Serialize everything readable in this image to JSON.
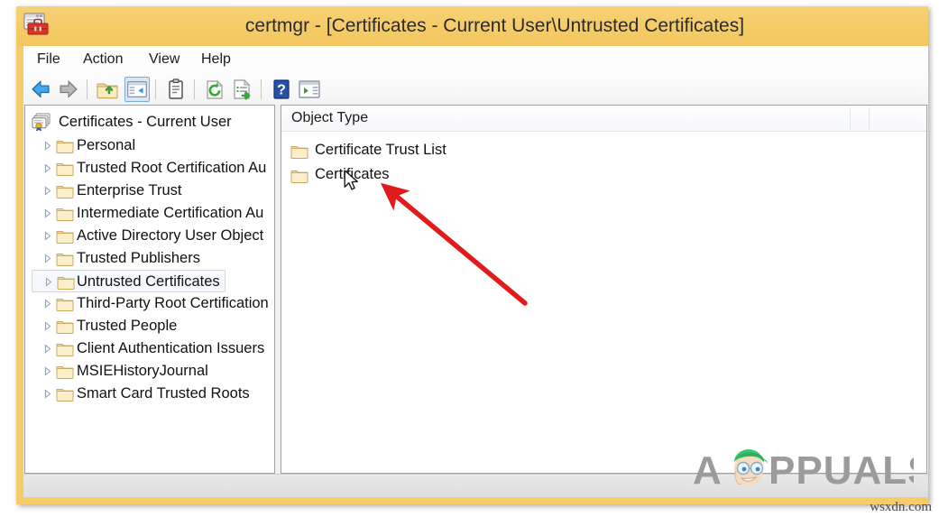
{
  "window": {
    "title": "certmgr - [Certificates - Current User\\Untrusted Certificates]",
    "icon": "certmgr-icon",
    "titlebar_color": "#f5cc6a",
    "frame_color": "#f5cc6a"
  },
  "menubar": {
    "items": [
      {
        "label": "File",
        "name": "menu-file"
      },
      {
        "label": "Action",
        "name": "menu-action"
      },
      {
        "label": "View",
        "name": "menu-view"
      },
      {
        "label": "Help",
        "name": "menu-help"
      }
    ]
  },
  "toolbar": {
    "buttons": [
      {
        "name": "back-arrow-icon",
        "title": "Back"
      },
      {
        "name": "forward-arrow-icon",
        "title": "Forward"
      },
      {
        "name": "up-one-level-icon",
        "title": "Up One Level"
      },
      {
        "name": "show-hide-console-tree-icon",
        "title": "Show/Hide Console Tree",
        "pressed": true
      },
      {
        "name": "properties-icon",
        "title": "Properties"
      },
      {
        "name": "refresh-icon",
        "title": "Refresh"
      },
      {
        "name": "export-list-icon",
        "title": "Export List"
      },
      {
        "name": "help-icon",
        "title": "Help"
      },
      {
        "name": "show-action-pane-icon",
        "title": "Show/Hide Action Pane"
      }
    ]
  },
  "tree": {
    "root": {
      "label": "Certificates - Current User",
      "icon": "certificates-store-icon"
    },
    "items": [
      {
        "label": "Personal",
        "selected": false
      },
      {
        "label": "Trusted Root Certification Au",
        "selected": false
      },
      {
        "label": "Enterprise Trust",
        "selected": false
      },
      {
        "label": "Intermediate Certification Au",
        "selected": false
      },
      {
        "label": "Active Directory User Object",
        "selected": false
      },
      {
        "label": "Trusted Publishers",
        "selected": false
      },
      {
        "label": "Untrusted Certificates",
        "selected": true
      },
      {
        "label": "Third-Party Root Certification",
        "selected": false
      },
      {
        "label": "Trusted People",
        "selected": false
      },
      {
        "label": "Client Authentication Issuers",
        "selected": false
      },
      {
        "label": "MSIEHistoryJournal",
        "selected": false
      },
      {
        "label": "Smart Card Trusted Roots",
        "selected": false
      }
    ]
  },
  "list": {
    "columns": [
      {
        "label": "Object Type",
        "name": "column-object-type"
      },
      {
        "label": "",
        "name": "column-blank"
      }
    ],
    "rows": [
      {
        "label": "Certificate Trust List",
        "icon": "folder-icon"
      },
      {
        "label": "Certificates",
        "icon": "folder-icon"
      }
    ]
  },
  "statusbar": {
    "text": ""
  },
  "watermark": {
    "brand": "PPUALS",
    "brand_first_letter": "A",
    "site": "wsxdn.com",
    "color": "#9b9b9b"
  },
  "annotation": {
    "arrow_color": "#e01b1b",
    "name": "red-pointer-arrow"
  },
  "cursor": {
    "name": "mouse-pointer"
  }
}
